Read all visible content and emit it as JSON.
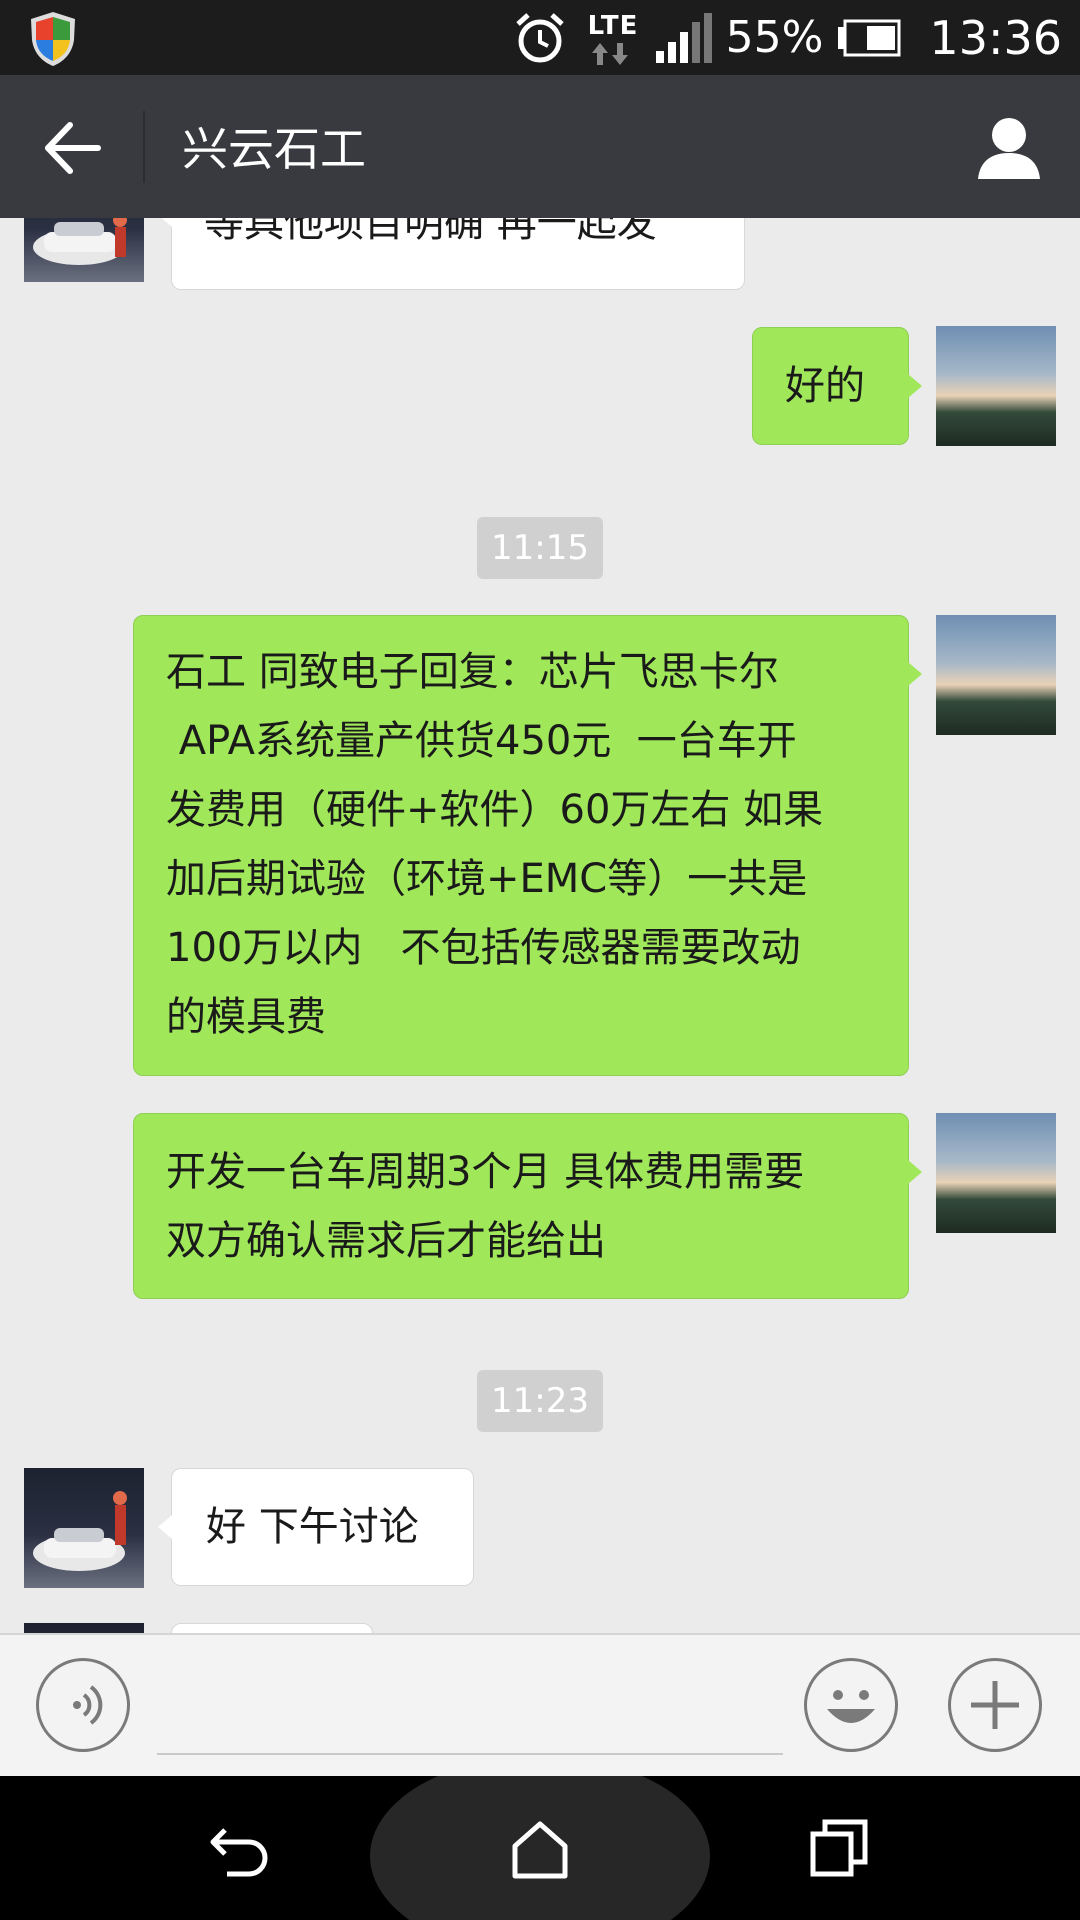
{
  "status_bar": {
    "network": "LTE",
    "battery_percent": "55%",
    "time": "13:36",
    "icons": [
      "shield-icon",
      "alarm-icon",
      "lte-data-icon",
      "signal-icon",
      "battery-icon"
    ]
  },
  "header": {
    "title": "兴云石工",
    "back_icon": "back-arrow-icon",
    "profile_icon": "person-icon"
  },
  "messages": [
    {
      "side": "left",
      "text": "等具他项目明确 再一起发"
    },
    {
      "side": "right",
      "text": "好的"
    },
    {
      "type": "time",
      "text": "11:15"
    },
    {
      "side": "right",
      "lines": [
        "石工  同致电子回复：芯片飞思卡尔",
        " APA系统量产供货450元  一台车开",
        "发费用（硬件+软件）60万左右  如果",
        "加后期试验（环境+EMC等）一共是",
        "100万以内   不包括传感器需要改动",
        "的模具费"
      ]
    },
    {
      "side": "right",
      "lines": [
        "开发一台车周期3个月  具体费用需要",
        "双方确认需求后才能给出"
      ]
    },
    {
      "type": "time",
      "text": "11:23"
    },
    {
      "side": "left",
      "text": "好 下午讨论"
    }
  ],
  "input_bar": {
    "placeholder": "",
    "voice_icon": "voice-icon",
    "emoji_icon": "emoji-icon",
    "plus_icon": "plus-icon"
  },
  "nav_bar": {
    "icons": [
      "nav-back-icon",
      "home-icon",
      "recent-apps-icon"
    ]
  },
  "colors": {
    "sent_bubble": "#a0e75a",
    "received_bubble": "#ffffff",
    "title_bar": "#393a3f",
    "chat_background": "#ebebeb"
  }
}
